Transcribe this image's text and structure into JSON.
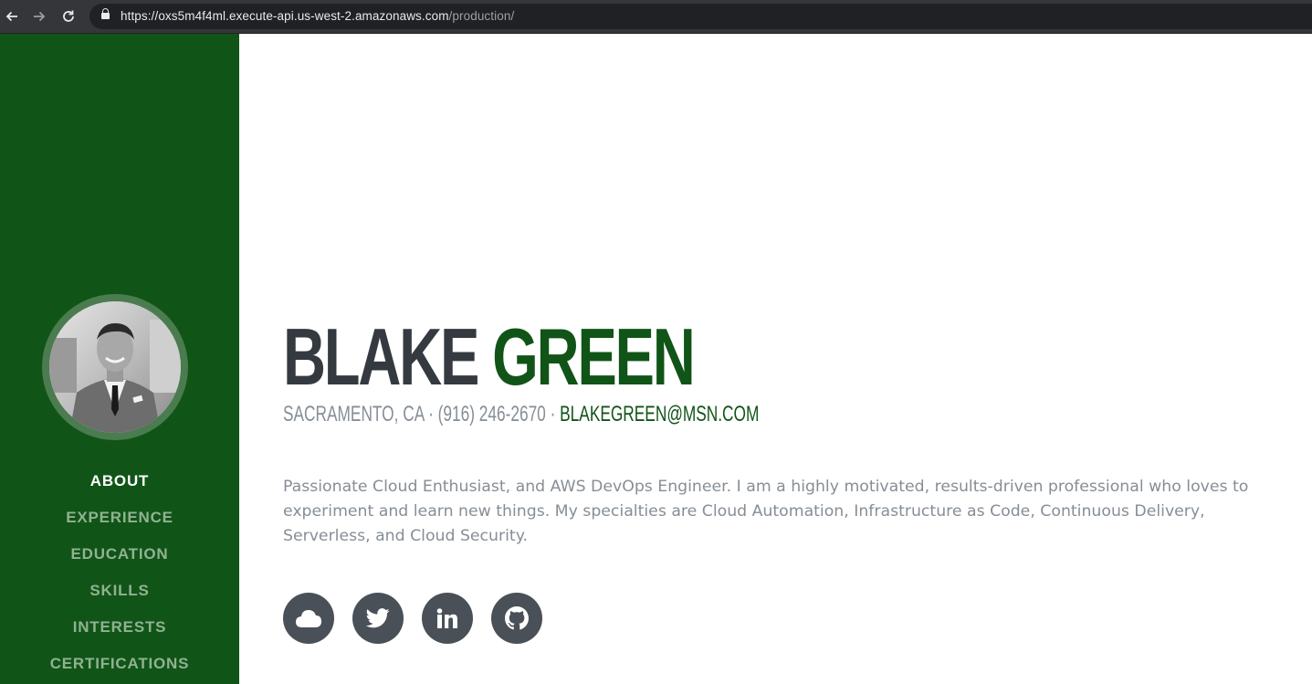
{
  "browser": {
    "url_host": "https://oxs5m4f4ml.execute-api.us-west-2.amazonaws.com",
    "url_path": "/production/",
    "back_icon": "arrow-left-icon",
    "forward_icon": "arrow-right-icon",
    "reload_icon": "reload-icon"
  },
  "sidebar": {
    "background_color": "#115417",
    "avatar_alt": "profile-photo",
    "nav": [
      {
        "label": "ABOUT",
        "active": true
      },
      {
        "label": "EXPERIENCE",
        "active": false
      },
      {
        "label": "EDUCATION",
        "active": false
      },
      {
        "label": "SKILLS",
        "active": false
      },
      {
        "label": "INTERESTS",
        "active": false
      },
      {
        "label": "CERTIFICATIONS",
        "active": false
      }
    ]
  },
  "about": {
    "first_name": "BLAKE",
    "last_name": "GREEN",
    "location_phone": "SACRAMENTO, CA · (916) 246-2670 · ",
    "email": "BLAKEGREEN@MSN.COM",
    "bio": "Passionate Cloud Enthusiast, and AWS DevOps Engineer. I am a highly motivated, results-driven professional who loves to experiment and learn new things. My specialties are Cloud Automation, Infrastructure as Code, Continuous Delivery, Serverless, and Cloud Security.",
    "accent_color": "#115417",
    "socials": [
      {
        "icon": "cloud-icon"
      },
      {
        "icon": "twitter-icon"
      },
      {
        "icon": "linkedin-icon"
      },
      {
        "icon": "github-icon"
      }
    ]
  }
}
